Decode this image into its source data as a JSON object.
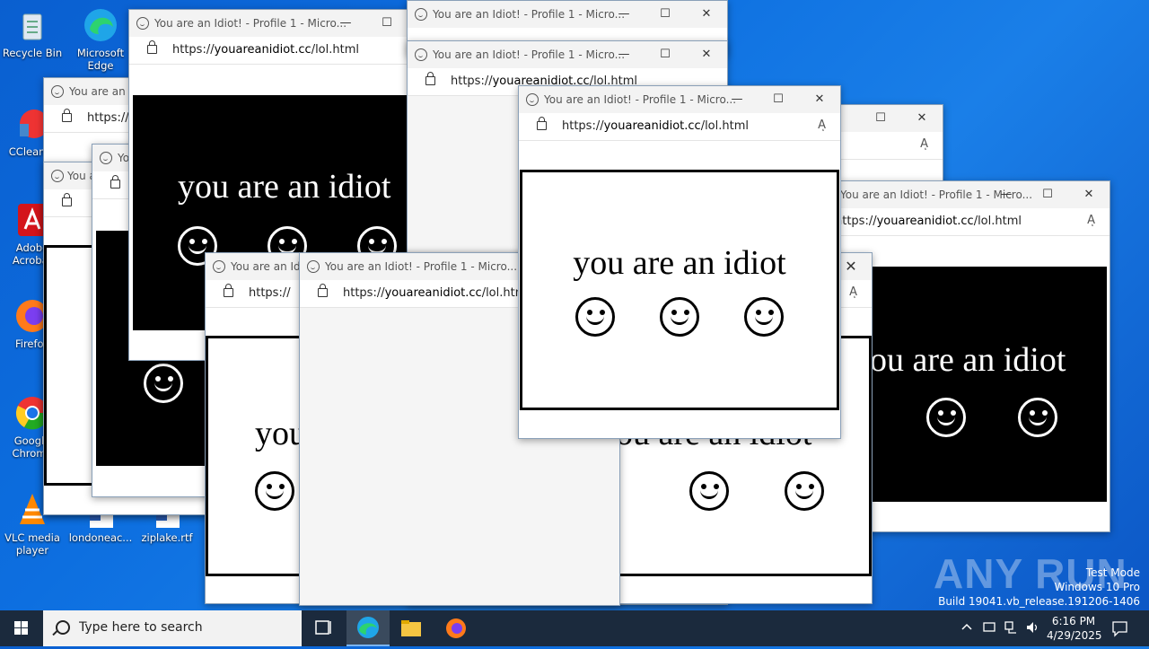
{
  "desktop": {
    "icons": [
      {
        "label": "Recycle Bin",
        "icon": "recycle-bin-icon"
      },
      {
        "label": "Microsoft Edge",
        "icon": "edge-icon"
      },
      {
        "label": "CCleaner",
        "icon": "ccleaner-icon"
      },
      {
        "label": "Adobe Acrobat",
        "icon": "acrobat-icon"
      },
      {
        "label": "Firefox",
        "icon": "firefox-icon"
      },
      {
        "label": "Google Chrome",
        "icon": "chrome-icon"
      },
      {
        "label": "VLC media player",
        "icon": "vlc-icon"
      },
      {
        "label": "londoneac...",
        "icon": "word-doc-icon"
      },
      {
        "label": "ziplake.rtf",
        "icon": "word-doc-icon"
      }
    ]
  },
  "browser": {
    "window_title": "You are an Idiot! - Profile 1 - Micro...",
    "window_title_short": "You are an Idi",
    "url_prefix": "https://",
    "url_domain": "youareanidiot.cc",
    "url_path": "/lol.html",
    "page_text": "you are an idiot",
    "page_text_partial": "you",
    "page_text_partial_b": "ou are an idiot",
    "page_text_partial_c": "you are an idiot",
    "minimize": "—",
    "maximize": "☐",
    "close": "✕",
    "read_aloud": "Aͅ"
  },
  "taskbar": {
    "search_placeholder": "Type here to search",
    "time": "6:16 PM",
    "date": "4/29/2025"
  },
  "watermark": {
    "line1": "Test Mode",
    "line2": "Windows 10 Pro",
    "line3": "Build 19041.vb_release.191206-1406",
    "brand": "ANY RUN"
  },
  "colors": {
    "taskbar": "#1b2a3d",
    "desktop": "#0d6fe0"
  }
}
